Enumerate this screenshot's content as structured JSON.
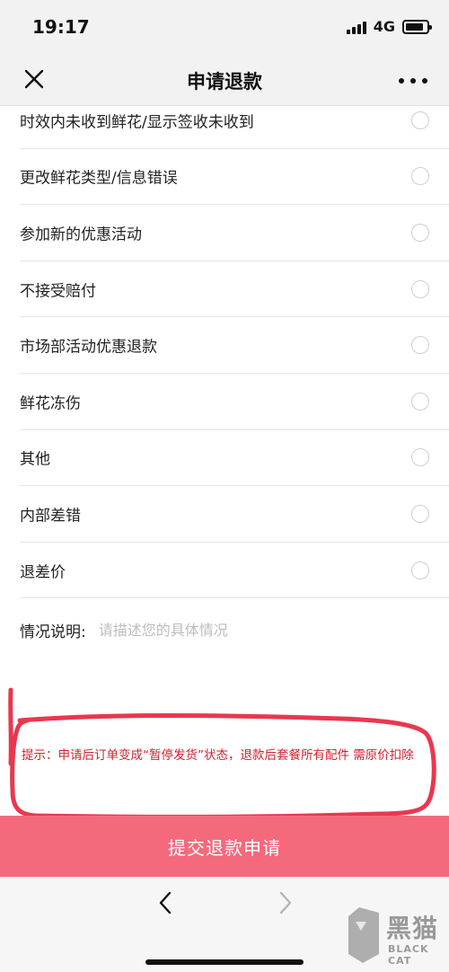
{
  "status_bar": {
    "time": "19:17",
    "network": "4G",
    "battery_level": 0.85
  },
  "nav": {
    "title": "申请退款",
    "close_icon": "close-icon",
    "more_icon": "more-icon"
  },
  "reasons": [
    {
      "label": "时效内未收到鲜花/显示签收未收到",
      "selected": false
    },
    {
      "label": "更改鲜花类型/信息错误",
      "selected": false
    },
    {
      "label": "参加新的优惠活动",
      "selected": false
    },
    {
      "label": "不接受赔付",
      "selected": false
    },
    {
      "label": "市场部活动优惠退款",
      "selected": false
    },
    {
      "label": "鲜花冻伤",
      "selected": false
    },
    {
      "label": "其他",
      "selected": false
    },
    {
      "label": "内部差错",
      "selected": false
    },
    {
      "label": "退差价",
      "selected": false
    }
  ],
  "description": {
    "label": "情况说明:",
    "placeholder": "请描述您的具体情况",
    "value": ""
  },
  "tip": {
    "text": "提示：申请后订单变成“暂停发货”状态，退款后套餐所有配件 需原价扣除"
  },
  "submit": {
    "label": "提交退款申请"
  },
  "browser_nav": {
    "back_icon": "chevron-left-icon",
    "forward_icon": "chevron-right-icon"
  },
  "watermark": {
    "main": "黑猫",
    "sub": "BLACK CAT"
  },
  "colors": {
    "submit_bg": "#f4697c",
    "tip_text": "#d0202e",
    "annotation_stroke": "#e8384f"
  }
}
